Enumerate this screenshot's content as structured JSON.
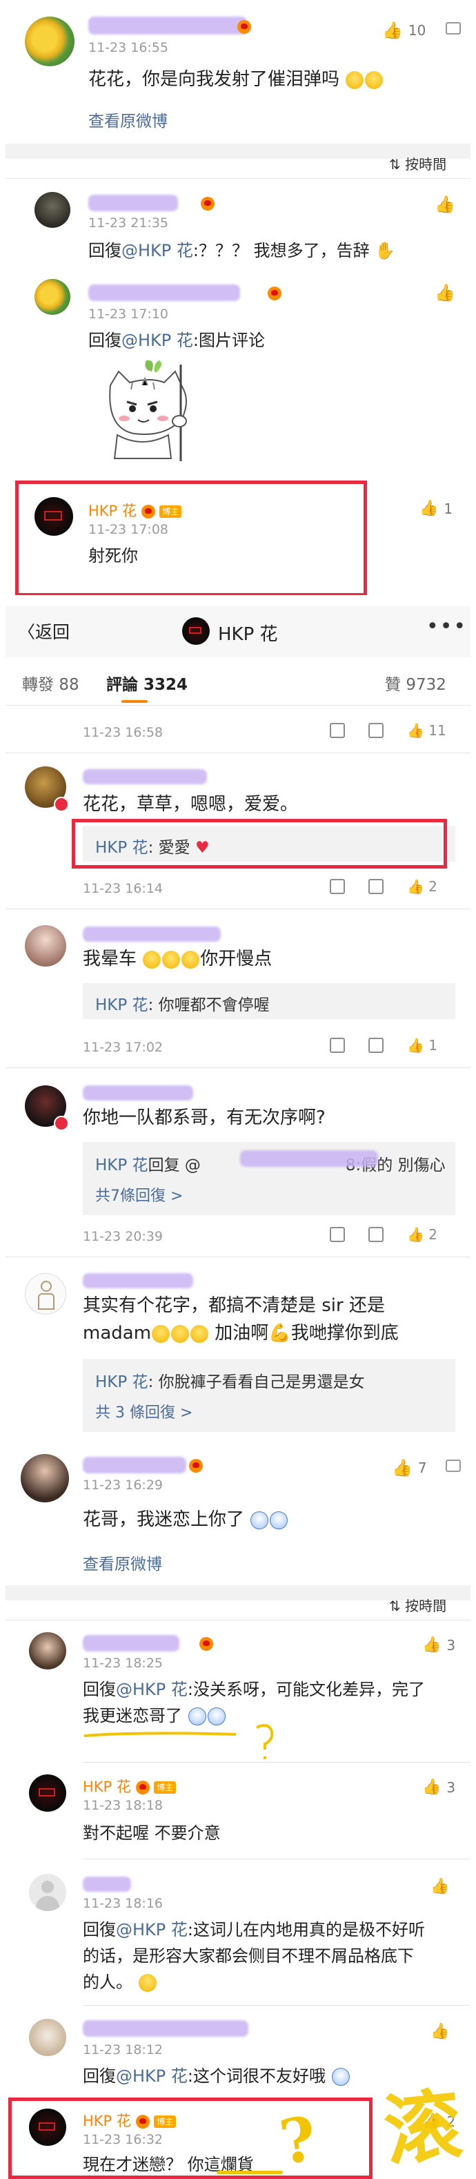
{
  "panel1": {
    "c1": {
      "time": "11-23 16:55",
      "text": "花花，你是向我发射了催泪弹吗",
      "view_original": "查看原微博",
      "likes": "10"
    },
    "sort_label": "按時間",
    "r1": {
      "time": "11-23 21:35",
      "reply": "回復",
      "mention": "@HKP 花",
      "text": ":？？？ 我想多了，告辞"
    },
    "r2": {
      "time": "11-23 17:10",
      "reply": "回復",
      "mention": "@HKP 花",
      "text": ":图片评论"
    },
    "r3": {
      "name": "HKP 花",
      "badge": "博主",
      "time": "11-23 17:08",
      "text": "射死你",
      "likes": "1"
    }
  },
  "panel2": {
    "back_label": "返回",
    "page_title": "HKP 花",
    "tabs": {
      "repost_label": "轉發",
      "repost_count": "88",
      "comment_label": "評論",
      "comment_count": "3324",
      "like_label": "贊",
      "like_count": "9732"
    },
    "row0": {
      "time": "11-23 16:58",
      "likes": "11"
    },
    "c1": {
      "text": "花花，草草，嗯嗯，爱爱。",
      "reply_author": "HKP 花",
      "reply_text": ": 愛愛",
      "time": "11-23 16:14",
      "likes": "2"
    },
    "c2": {
      "text": "我晕车",
      "text2": "你开慢点",
      "reply_author": "HKP 花",
      "reply_text": ": 你喱都不會停喔",
      "time": "11-23 17:02",
      "likes": "1"
    },
    "c3": {
      "text": "你地一队都系哥，有无次序啊?",
      "reply_author": "HKP 花",
      "reply_mid": "回复 @",
      "reply_text": "8:假的 別傷心",
      "more": "共7條回復 >",
      "time": "11-23 20:39",
      "likes": "2"
    },
    "c4": {
      "text": "其实有个花字，都搞不清楚是 sir 还是",
      "text2": "madam",
      "text3": "加油啊",
      "text4": "我哋撑你到底",
      "reply_author": "HKP 花",
      "reply_text": ": 你脫褲子看看自己是男還是女",
      "more": "共 3 條回復 >"
    }
  },
  "panel3": {
    "c1": {
      "time": "11-23 16:29",
      "text": "花哥，我迷恋上你了",
      "view_original": "查看原微博",
      "likes": "7"
    },
    "sort_label": "按時間",
    "r1": {
      "time": "11-23 18:25",
      "reply": "回復",
      "mention": "@HKP 花",
      "text": ":没关系呀，可能文化差异，完了",
      "text2": "我更迷恋哥了",
      "likes": "3"
    },
    "r2": {
      "name": "HKP 花",
      "badge": "博主",
      "time": "11-23 18:18",
      "text": "對不起喔 不要介意",
      "likes": "3"
    },
    "r3": {
      "time": "11-23 18:16",
      "reply": "回復",
      "mention": "@HKP 花",
      "text": ":这词儿在内地用真的是极不好听",
      "text2": "的话，是形容大家都会侧目不理不屑品格底下",
      "text3": "的人。"
    },
    "r4": {
      "time": "11-23 18:12",
      "reply": "回復",
      "mention": "@HKP 花",
      "text": ":这个词很不友好哦"
    },
    "r5": {
      "name": "HKP 花",
      "badge": "博主",
      "time": "11-23 16:32",
      "text": "現在才迷戀？ 你這爛貨",
      "likes": "2"
    }
  },
  "doodle": {
    "mark": "?",
    "char": "滚"
  }
}
